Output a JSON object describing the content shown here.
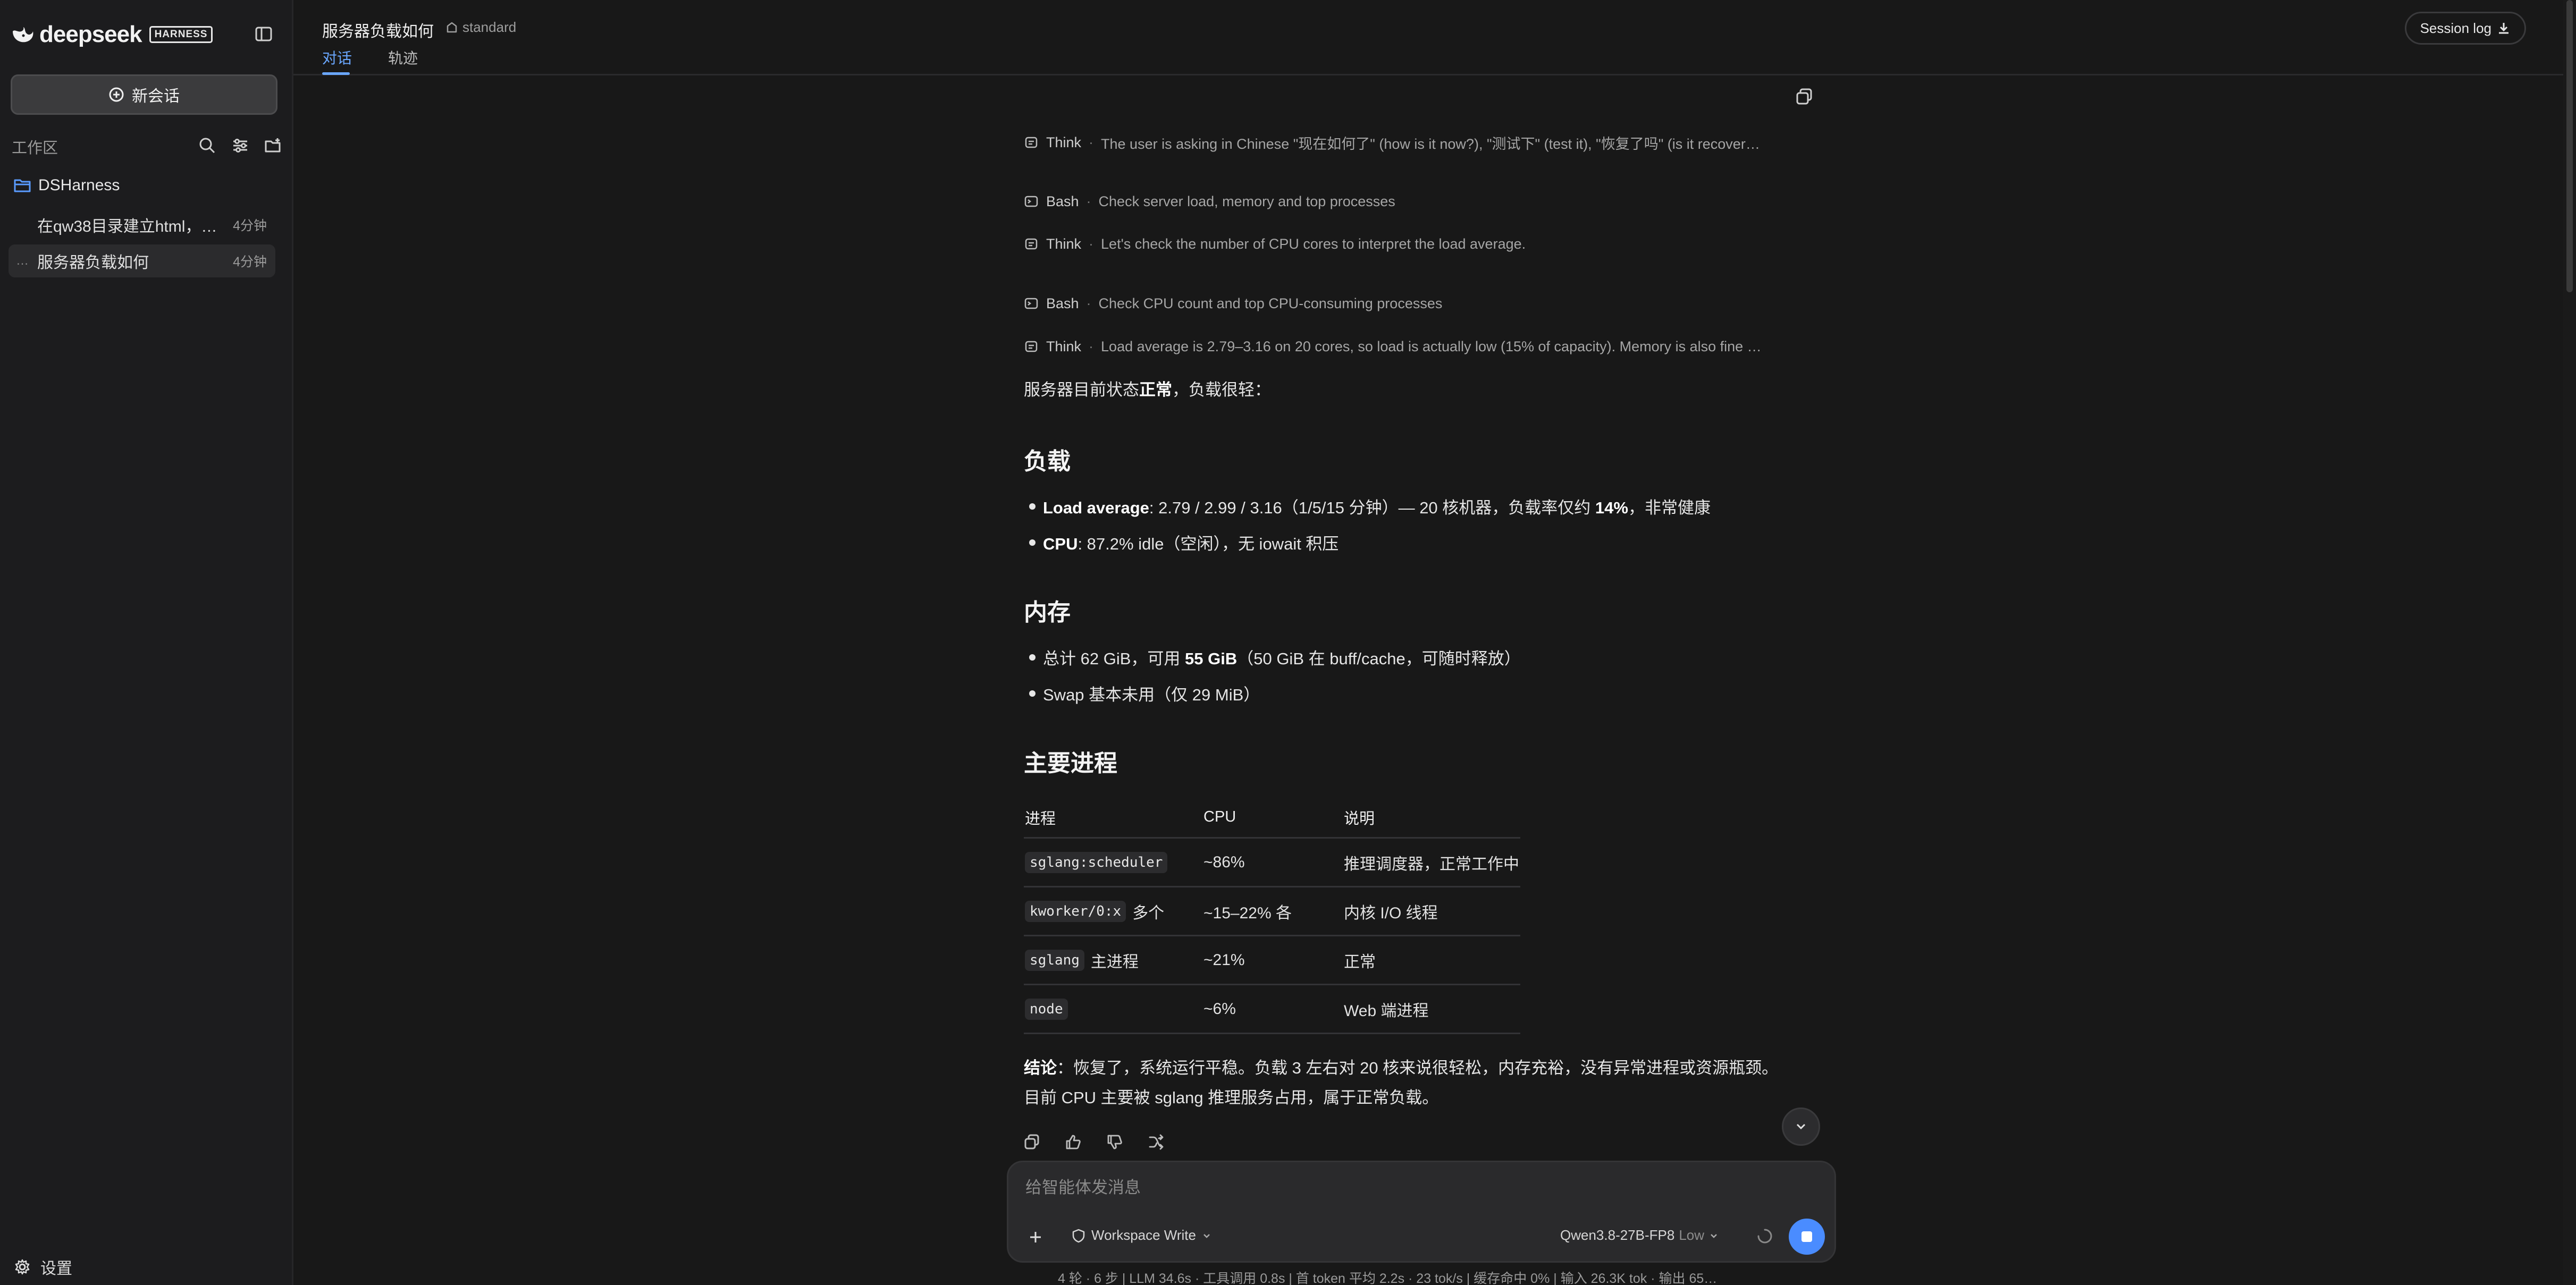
{
  "brand": {
    "name": "deepseek",
    "badge": "HARNESS"
  },
  "sidebar": {
    "new_chat_label": "新会话",
    "workspace_label": "工作区",
    "folder": "DSHarness",
    "sessions": [
      {
        "title": "在qw38目录建立html，表…",
        "age": "4分钟"
      },
      {
        "title": "服务器负载如何",
        "age": "4分钟",
        "dots": "…"
      }
    ],
    "settings_label": "设置"
  },
  "header": {
    "title": "服务器负载如何",
    "mode": "standard",
    "tabs": [
      "对话",
      "轨迹"
    ],
    "session_log": "Session log"
  },
  "steps": [
    {
      "kind": "Think",
      "text": "The user is asking in Chinese \"现在如何了\" (how is it now?), \"测试下\" (test it), \"恢复了吗\" (is it recover…"
    },
    {
      "kind": "Bash",
      "text": "Check server load, memory and top processes"
    },
    {
      "kind": "Think",
      "text": "Let's check the number of CPU cores to interpret the load average."
    },
    {
      "kind": "Bash",
      "text": "Check CPU count and top CPU-consuming processes"
    },
    {
      "kind": "Think",
      "text": "Load average is 2.79–3.16 on 20 cores, so load is actually low (15% of capacity). Memory is also fine …"
    }
  ],
  "answer": {
    "intro_a": "服务器目前状态",
    "intro_b": "正常",
    "intro_c": "，负载很轻：",
    "h_load": "负载",
    "load1_label": "Load average",
    "load1_text": ": 2.79 / 2.99 / 3.16（1/5/15 分钟）— 20 核机器，负载率仅约 ",
    "load1_pct": "14%",
    "load1_tail": "，非常健康",
    "cpu_label": "CPU",
    "cpu_text": ": 87.2% idle（空闲），无 iowait 积压",
    "h_mem": "内存",
    "mem1_a": "总计 62 GiB，可用 ",
    "mem1_b": "55 GiB",
    "mem1_c": "（50 GiB 在 buff/cache，可随时释放）",
    "mem2": "Swap 基本未用（仅 29 MiB）",
    "h_proc": "主要进程",
    "table": {
      "headers": [
        "进程",
        "CPU",
        "说明"
      ],
      "rows": [
        {
          "code": "sglang:scheduler",
          "suffix": "",
          "cpu": "~86%",
          "desc": "推理调度器，正常工作中"
        },
        {
          "code": "kworker/0:x",
          "suffix": "多个",
          "cpu": "~15–22% 各",
          "desc": "内核 I/O 线程"
        },
        {
          "code": "sglang",
          "suffix": "主进程",
          "cpu": "~21%",
          "desc": "正常"
        },
        {
          "code": "node",
          "suffix": "",
          "cpu": "~6%",
          "desc": "Web 端进程"
        }
      ]
    },
    "conclusion_label": "结论",
    "conclusion_line1": "：恢复了，系统运行平稳。负载 3 左右对 20 核来说很轻松，内存充裕，没有异常进程或资源瓶颈。",
    "conclusion_line2": "目前 CPU 主要被 sglang 推理服务占用，属于正常负载。"
  },
  "composer": {
    "placeholder": "给智能体发消息",
    "permission": "Workspace Write",
    "model": "Qwen3.8-27B-FP8",
    "effort": "Low"
  },
  "stats": "4 轮 · 6 步   |   LLM 34.6s · 工具调用 0.8s   |   首 token 平均 2.2s · 23 tok/s   |   缓存命中 0%   |   输入 26.3K tok · 输出 65…",
  "colors": {
    "accent": "#4a8cff",
    "tab_active": "#6aa7ff",
    "bg": "#181818",
    "sidebar_bg": "#1c1c1e"
  }
}
